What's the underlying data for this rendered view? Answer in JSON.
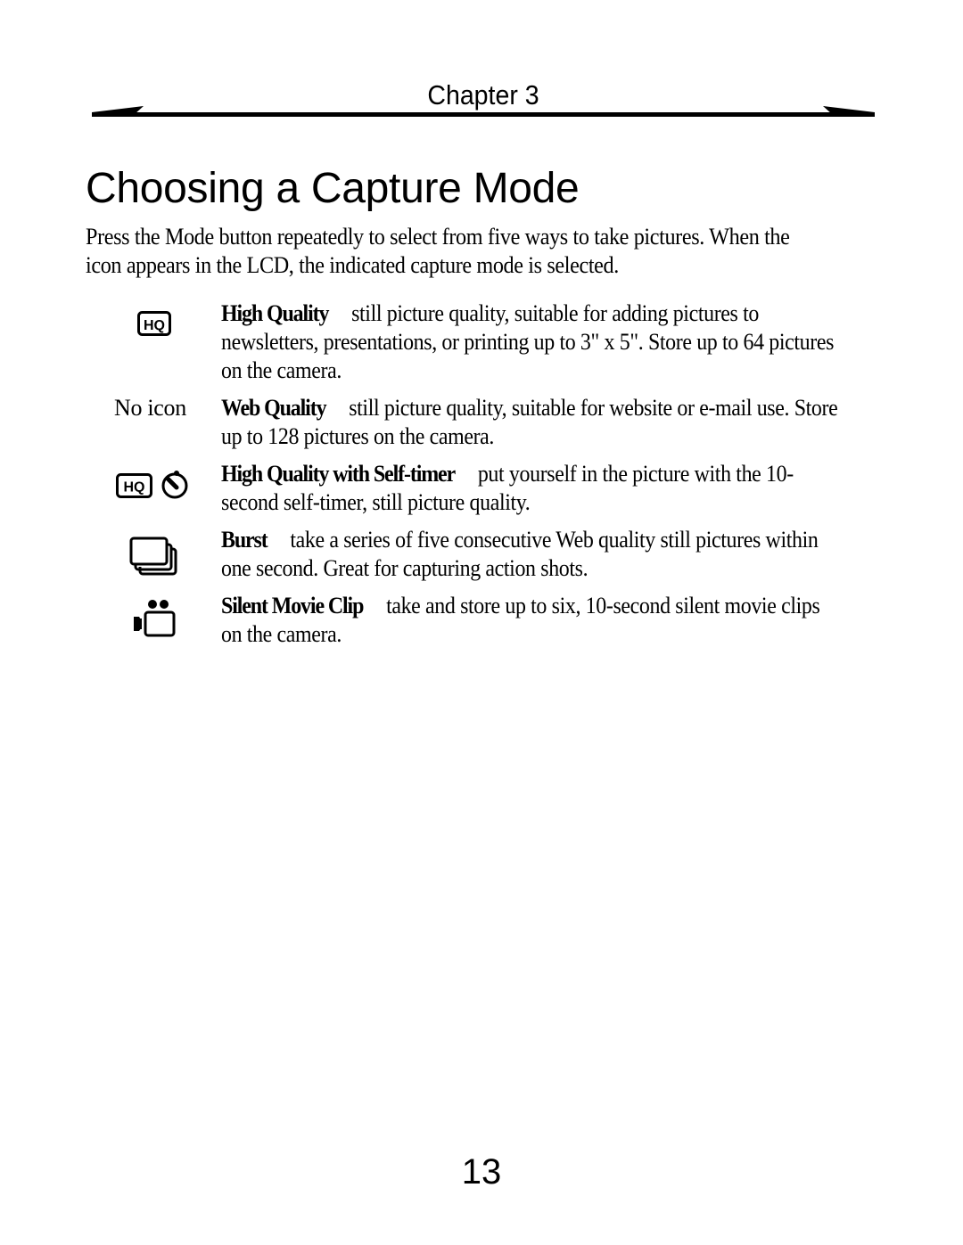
{
  "header": {
    "chapter": "Chapter 3"
  },
  "page": {
    "title": "Choosing a Capture Mode",
    "intro": "Press the Mode button repeatedly to select from five ways to take pictures. When the icon appears in the LCD, the indicated capture mode is selected.",
    "page_number": "13"
  },
  "modes": [
    {
      "icon": "hq-icon",
      "icon_label": "",
      "name": "High Quality",
      "description": "still picture quality, suitable for adding pictures to newsletters, presentations, or printing up to 3\" x 5\". Store up to 64 pictures on the camera."
    },
    {
      "icon": "none",
      "icon_label": "No icon",
      "name": "Web Quality",
      "description": "still picture quality, suitable for website or e-mail use. Store up to 128 pictures on the camera."
    },
    {
      "icon": "hq-self-timer-icon",
      "icon_label": "",
      "name": "High Quality with Self-timer",
      "description": "put yourself in the picture with the 10-second self-timer, still picture quality."
    },
    {
      "icon": "burst-icon",
      "icon_label": "",
      "name": "Burst",
      "description": "take a series of five consecutive Web quality still pictures within one second. Great for capturing action shots."
    },
    {
      "icon": "movie-camera-icon",
      "icon_label": "",
      "name": "Silent Movie Clip",
      "description": "take and store up to six, 10-second silent movie clips on the camera."
    }
  ]
}
